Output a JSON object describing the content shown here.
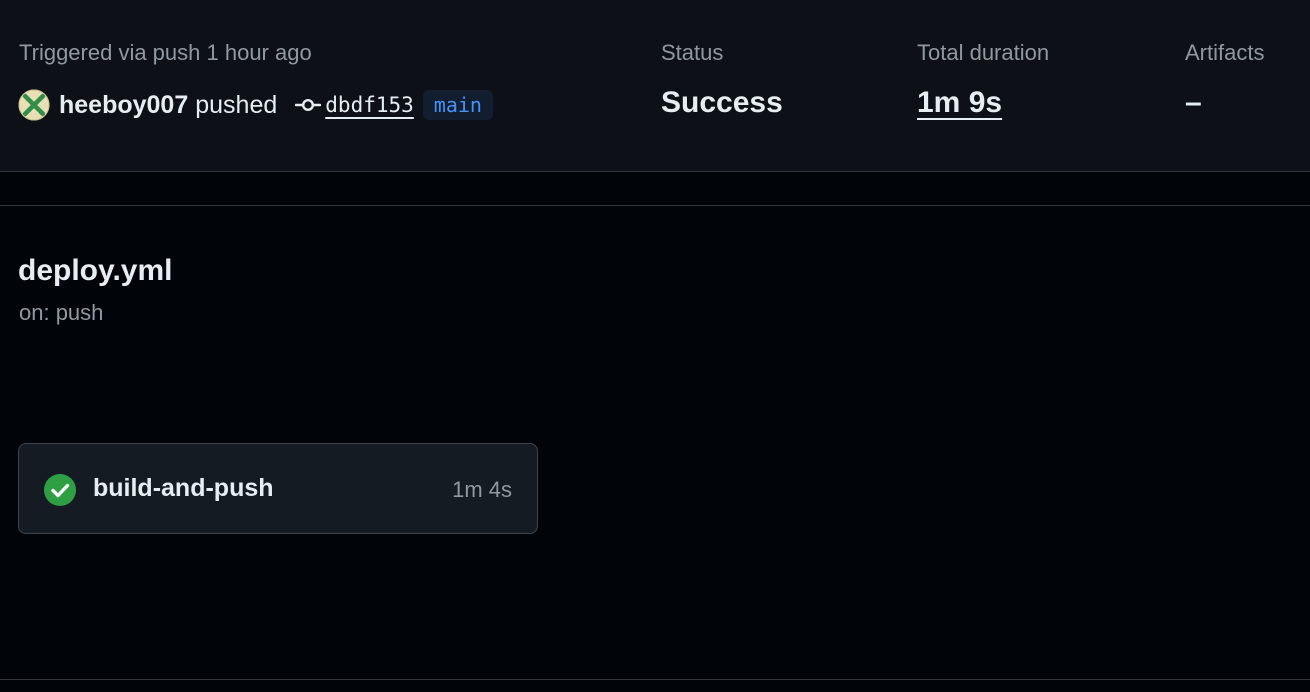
{
  "summary": {
    "trigger_label": "Triggered via push 1 hour ago",
    "actor": "heeboy007",
    "action": "pushed",
    "commit_sha": "dbdf153",
    "branch": "main",
    "status_label": "Status",
    "status_value": "Success",
    "duration_label": "Total duration",
    "duration_value": "1m 9s",
    "artifacts_label": "Artifacts",
    "artifacts_value": "–"
  },
  "workflow": {
    "name": "deploy.yml",
    "trigger": "on: push",
    "jobs": [
      {
        "name": "build-and-push",
        "duration": "1m 4s",
        "status": "success",
        "status_icon": "check-circle-fill-icon"
      }
    ]
  },
  "colors": {
    "success": "#2ea043",
    "branch_text": "#4493f8",
    "muted_text": "#9198a1"
  }
}
